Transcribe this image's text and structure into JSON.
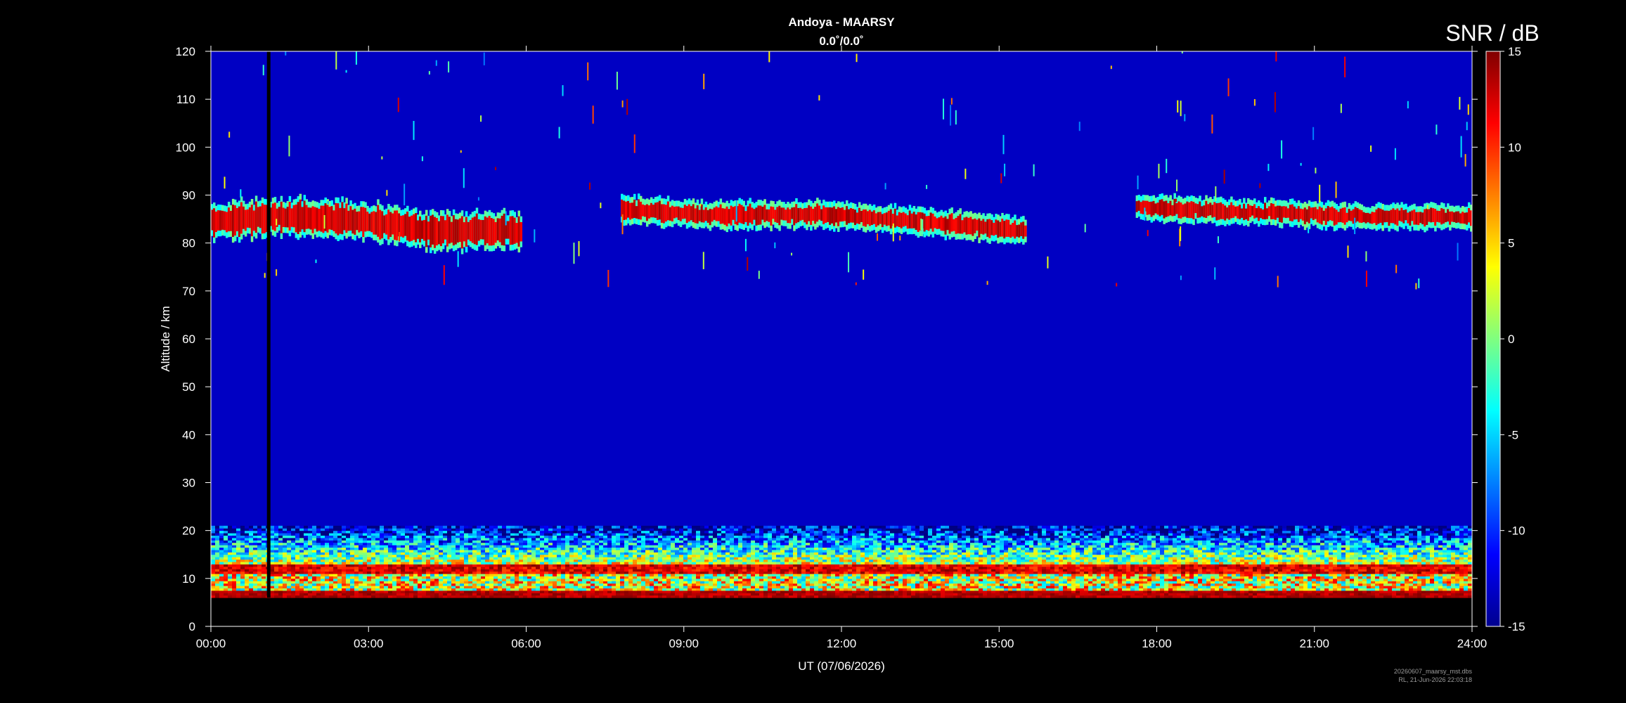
{
  "chart_data": {
    "type": "heatmap",
    "title": "Andoya - MAARSY",
    "subtitle": "0.0˚/0.0˚",
    "xlabel": "UT (07/06/2026)",
    "ylabel": "Altitude / km",
    "x_unit": "hours",
    "xlim": [
      0,
      24
    ],
    "ylim": [
      0,
      120
    ],
    "x_ticks": [
      0,
      3,
      6,
      9,
      12,
      15,
      18,
      21,
      24
    ],
    "x_tick_labels": [
      "00:00",
      "03:00",
      "06:00",
      "09:00",
      "12:00",
      "15:00",
      "18:00",
      "21:00",
      "24:00"
    ],
    "y_ticks": [
      0,
      10,
      20,
      30,
      40,
      50,
      60,
      70,
      80,
      90,
      100,
      110,
      120
    ],
    "y_tick_labels": [
      "0",
      "10",
      "20",
      "30",
      "40",
      "50",
      "60",
      "70",
      "80",
      "90",
      "100",
      "110",
      "120"
    ],
    "colorbar": {
      "label": "SNR / dB",
      "range": [
        -15,
        15
      ],
      "ticks": [
        -15,
        -10,
        -5,
        0,
        5,
        10,
        15
      ],
      "tick_labels": [
        "-15",
        "-10",
        "-5",
        "0",
        "5",
        "10",
        "15"
      ],
      "colormap": "jet"
    },
    "data_gap": {
      "time_h": 1.1,
      "alt_range_km": [
        6,
        120
      ]
    },
    "no_data_below_km": 6,
    "background_snr_db": -13,
    "layers": [
      {
        "kind": "PMSE",
        "t_start": 0.0,
        "t_end": 5.9,
        "centers_km": [
          [
            0,
            84.5
          ],
          [
            1.5,
            85.5
          ],
          [
            3.0,
            84.5
          ],
          [
            4.2,
            82.5
          ],
          [
            5.9,
            82.5
          ]
        ],
        "half_thickness_km": 2.6,
        "peak_snr_db": 14
      },
      {
        "kind": "PMSE",
        "t_start": 7.8,
        "t_end": 15.5,
        "centers_km": [
          [
            7.8,
            87.0
          ],
          [
            9.5,
            85.8
          ],
          [
            11.5,
            86.0
          ],
          [
            13.5,
            84.5
          ],
          [
            15.5,
            82.5
          ]
        ],
        "half_thickness_km": 1.6,
        "peak_snr_db": 14
      },
      {
        "kind": "PMSE",
        "t_start": 17.6,
        "t_end": 24.0,
        "centers_km": [
          [
            17.6,
            87.5
          ],
          [
            19.5,
            86.5
          ],
          [
            22.0,
            85.5
          ],
          [
            24.0,
            85.5
          ]
        ],
        "half_thickness_km": 1.4,
        "peak_snr_db": 14
      },
      {
        "kind": "tropo-stratosphere",
        "t_start": 0.0,
        "t_end": 24.0,
        "alt_range_km": [
          6,
          21
        ],
        "peak_snr_db": 15
      }
    ],
    "grid": false
  },
  "footer": {
    "line1": "20260607_maarsy_mst.dbs",
    "line2": "RL, 21-Jun-2026 22:03:18"
  },
  "colors": {
    "background": "#000000",
    "axis": "#ffffff",
    "footer_text": "#9a9a9a"
  }
}
